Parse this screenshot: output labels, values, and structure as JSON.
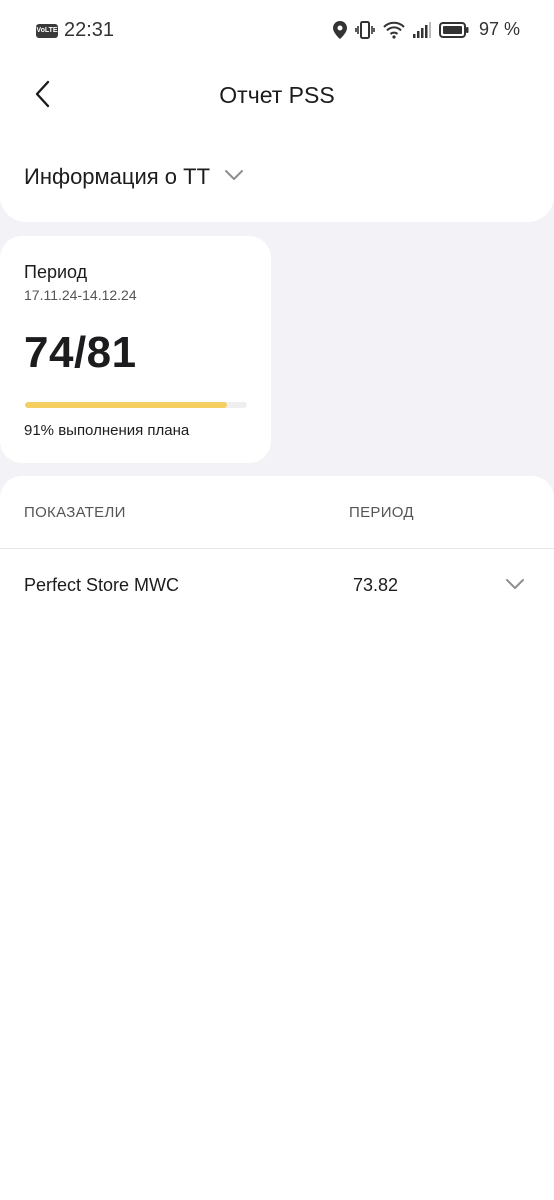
{
  "status_bar": {
    "network_badge": "VoLTE",
    "time": "22:31",
    "battery_percent": "97 %",
    "icons": [
      "location-icon",
      "vibrate-icon",
      "wifi-icon",
      "signal-icon",
      "battery-icon"
    ]
  },
  "header": {
    "back_icon": "chevron-left-icon",
    "title": "Отчет PSS"
  },
  "info_section": {
    "label": "Информация о ТТ",
    "icon": "chevron-down-icon"
  },
  "period_card": {
    "label": "Период",
    "dates": "17.11.24-14.12.24",
    "score": "74/81",
    "progress_fraction": 0.91,
    "plan_text": "91% выполнения плана",
    "accent_color": "#f5cf62"
  },
  "table": {
    "headers": [
      "ПОКАЗАТЕЛИ",
      "ПЕРИОД"
    ],
    "rows": [
      {
        "name": "Perfect Store MWC",
        "value": "73.82",
        "icon": "chevron-down-icon"
      }
    ]
  }
}
